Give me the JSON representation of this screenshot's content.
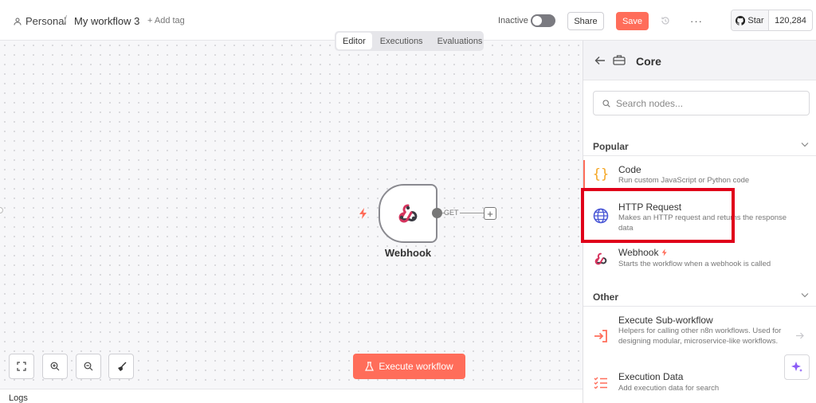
{
  "header": {
    "breadcrumb_user": "Personal",
    "breadcrumb_separator": "/",
    "workflow_title": "My workflow 3",
    "add_tag_label": "+ Add tag",
    "status_label": "Inactive",
    "share_label": "Share",
    "save_label": "Save",
    "more_label": "···",
    "github_star_label": "Star",
    "github_star_count": "120,284"
  },
  "view_tabs": [
    {
      "label": "Editor",
      "active": true
    },
    {
      "label": "Executions",
      "active": false
    },
    {
      "label": "Evaluations",
      "active": false
    }
  ],
  "canvas": {
    "node_name": "Webhook",
    "connection_label": "GET",
    "execute_button_label": "Execute workflow"
  },
  "logs_label": "Logs",
  "panel": {
    "title": "Core",
    "search_placeholder": "Search nodes...",
    "sections": {
      "popular": {
        "title": "Popular",
        "items": [
          {
            "title": "Code",
            "description": "Run custom JavaScript or Python code",
            "icon": "code-braces-icon"
          },
          {
            "title": "HTTP Request",
            "description": "Makes an HTTP request and returns the response data",
            "icon": "globe-icon"
          },
          {
            "title": "Webhook",
            "description": "Starts the workflow when a webhook is called",
            "icon": "webhook-icon"
          }
        ]
      },
      "other": {
        "title": "Other",
        "items": [
          {
            "title": "Execute Sub-workflow",
            "description": "Helpers for calling other n8n workflows. Used for designing modular, microservice-like workflows.",
            "icon": "sign-in-icon"
          },
          {
            "title": "Execution Data",
            "description": "Add execution data for search",
            "icon": "list-check-icon"
          }
        ]
      }
    }
  },
  "colors": {
    "accent": "#ff6d5a",
    "highlight": "#e0001a",
    "globe": "#4a57d6",
    "code": "#f5a623"
  }
}
